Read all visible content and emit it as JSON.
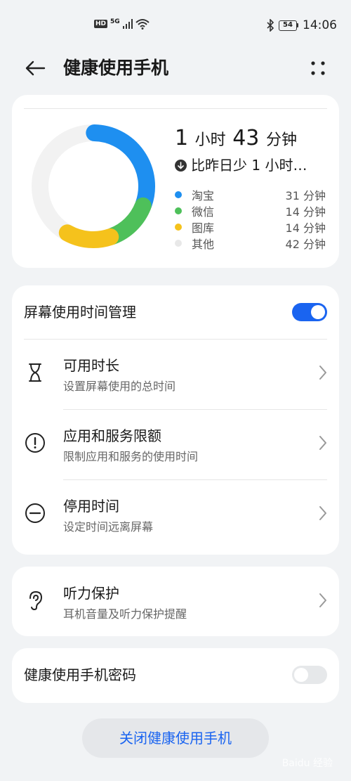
{
  "status": {
    "hd": "HD",
    "network": "5G",
    "battery": "54",
    "time": "14:06"
  },
  "header": {
    "title": "健康使用手机"
  },
  "summary": {
    "total_hours": "1",
    "hours_unit": "小时",
    "total_minutes": "43",
    "minutes_unit": "分钟",
    "compare_text": "比昨日少 1 小时…",
    "apps": [
      {
        "name": "淘宝",
        "value": "31 分钟",
        "minutes": 31,
        "color": "#1e8ff0"
      },
      {
        "name": "微信",
        "value": "14 分钟",
        "minutes": 14,
        "color": "#4ec05a"
      },
      {
        "name": "图库",
        "value": "14 分钟",
        "minutes": 14,
        "color": "#f5c21c"
      },
      {
        "name": "其他",
        "value": "42 分钟",
        "minutes": 42,
        "color": "#f0f0f0"
      }
    ]
  },
  "screen_time": {
    "label": "屏幕使用时间管理",
    "enabled": true,
    "items": [
      {
        "title": "可用时长",
        "subtitle": "设置屏幕使用的总时间",
        "icon": "hourglass-icon"
      },
      {
        "title": "应用和服务限额",
        "subtitle": "限制应用和服务的使用时间",
        "icon": "alert-circle-icon"
      },
      {
        "title": "停用时间",
        "subtitle": "设定时间远离屏幕",
        "icon": "minus-circle-icon"
      }
    ]
  },
  "hearing": {
    "title": "听力保护",
    "subtitle": "耳机音量及听力保护提醒",
    "icon": "ear-icon"
  },
  "password": {
    "label": "健康使用手机密码",
    "enabled": false
  },
  "close_button": "关闭健康使用手机",
  "watermark": "Baidu 经验"
}
